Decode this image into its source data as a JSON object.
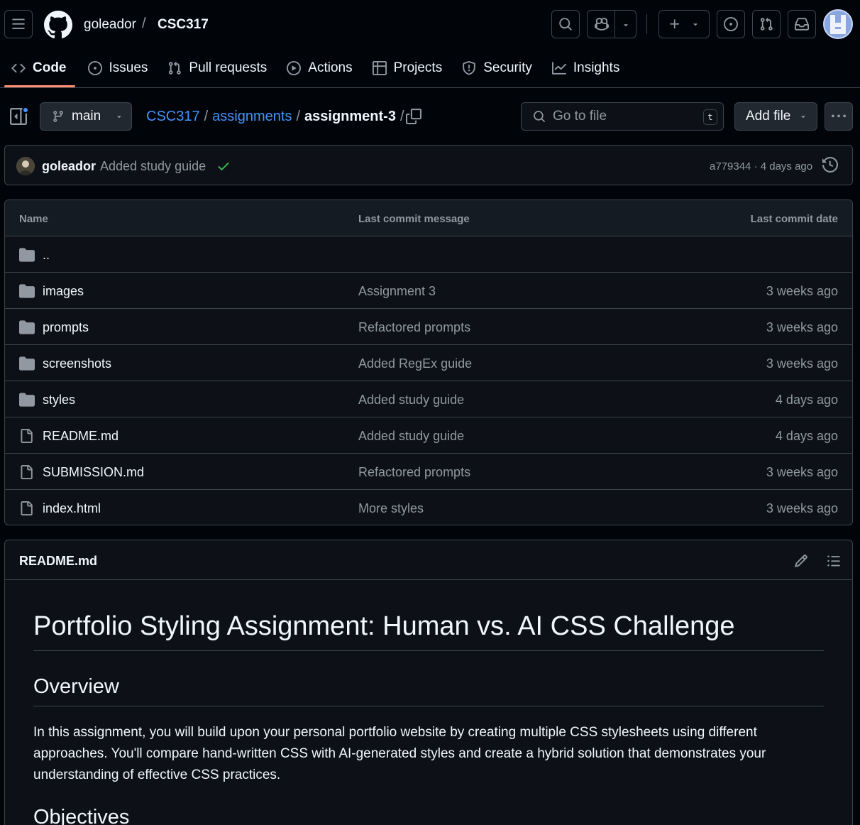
{
  "header": {
    "owner": "goleador",
    "separator": "/",
    "repo": "CSC317"
  },
  "tabs": [
    {
      "label": "Code",
      "icon": "code-icon"
    },
    {
      "label": "Issues",
      "icon": "issue-icon"
    },
    {
      "label": "Pull requests",
      "icon": "pull-request-icon"
    },
    {
      "label": "Actions",
      "icon": "play-icon"
    },
    {
      "label": "Projects",
      "icon": "table-icon"
    },
    {
      "label": "Security",
      "icon": "shield-icon"
    },
    {
      "label": "Insights",
      "icon": "graph-icon"
    }
  ],
  "toolbar": {
    "branch": "main",
    "breadcrumb": {
      "root": "CSC317",
      "sep": "/",
      "folder": "assignments",
      "current": "assignment-3"
    },
    "go_to_file_placeholder": "Go to file",
    "shortcut_key": "t",
    "add_file_label": "Add file"
  },
  "commit": {
    "author": "goleador",
    "message": "Added study guide",
    "meta": "a779344 · 4 days ago"
  },
  "file_table": {
    "headers": {
      "name": "Name",
      "message": "Last commit message",
      "date": "Last commit date"
    },
    "rows": [
      {
        "type": "folder",
        "name": "..",
        "message": "",
        "date": ""
      },
      {
        "type": "folder",
        "name": "images",
        "message": "Assignment 3",
        "date": "3 weeks ago"
      },
      {
        "type": "folder",
        "name": "prompts",
        "message": "Refactored prompts",
        "date": "3 weeks ago"
      },
      {
        "type": "folder",
        "name": "screenshots",
        "message": "Added RegEx guide",
        "date": "3 weeks ago"
      },
      {
        "type": "folder",
        "name": "styles",
        "message": "Added study guide",
        "date": "4 days ago"
      },
      {
        "type": "file",
        "name": "README.md",
        "message": "Added study guide",
        "date": "4 days ago"
      },
      {
        "type": "file",
        "name": "SUBMISSION.md",
        "message": "Refactored prompts",
        "date": "3 weeks ago"
      },
      {
        "type": "file",
        "name": "index.html",
        "message": "More styles",
        "date": "3 weeks ago"
      }
    ]
  },
  "readme": {
    "filename": "README.md",
    "h1": "Portfolio Styling Assignment: Human vs. AI CSS Challenge",
    "overview_heading": "Overview",
    "overview_text": "In this assignment, you will build upon your personal portfolio website by creating multiple CSS stylesheets using different approaches. You'll compare hand-written CSS with AI-generated styles and create a hybrid solution that demonstrates your understanding of effective CSS practices.",
    "objectives_heading": "Objectives"
  },
  "colors": {
    "background": "#010409",
    "panel": "#0d1117",
    "border": "#3d444d",
    "link": "#4493f8",
    "muted": "#9198a1",
    "success": "#3fb950",
    "tab_underline": "#fd8c73"
  }
}
